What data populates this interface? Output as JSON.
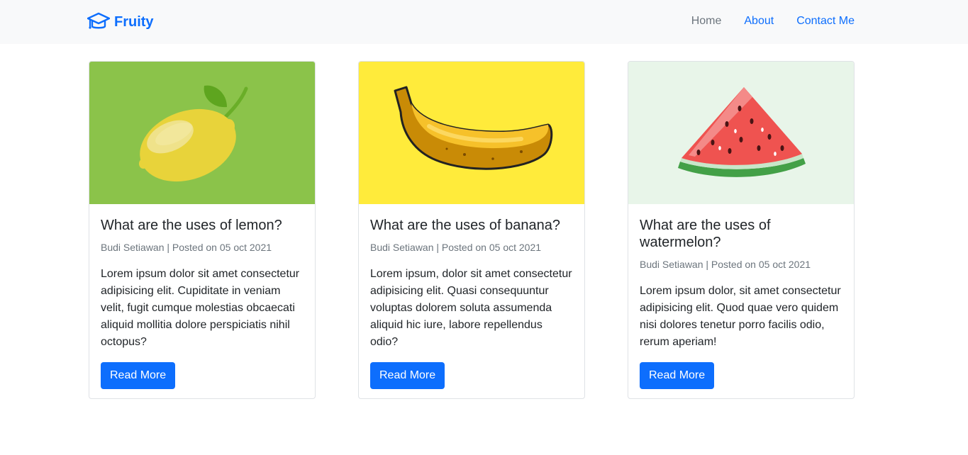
{
  "brand": {
    "name": "Fruity",
    "icon": "graduation-cap-icon",
    "color": "#0d6efd"
  },
  "nav": {
    "items": [
      {
        "label": "Home",
        "active": true
      },
      {
        "label": "About",
        "active": false
      },
      {
        "label": "Contact Me",
        "active": false
      }
    ]
  },
  "cards": [
    {
      "image": "lemon-illustration",
      "bg": "#8bc34a",
      "title": "What are the uses of lemon?",
      "meta": "Budi Setiawan | Posted on 05 oct 2021",
      "text": "Lorem ipsum dolor sit amet consectetur adipisicing elit. Cupiditate in veniam velit, fugit cumque molestias obcaecati aliquid mollitia dolore perspiciatis nihil octopus?",
      "button": "Read More"
    },
    {
      "image": "banana-illustration",
      "bg": "#ffeb3b",
      "title": "What are the uses of banana?",
      "meta": "Budi Setiawan | Posted on 05 oct 2021",
      "text": "Lorem ipsum, dolor sit amet consectetur adipisicing elit. Quasi consequuntur voluptas dolorem soluta assumenda aliquid hic iure, labore repellendus odio?",
      "button": "Read More"
    },
    {
      "image": "watermelon-illustration",
      "bg": "#e8f5e9",
      "title": "What are the uses of watermelon?",
      "meta": "Budi Setiawan | Posted on 05 oct 2021",
      "text": "Lorem ipsum dolor, sit amet consectetur adipisicing elit. Quod quae vero quidem nisi dolores tenetur porro facilis odio, rerum aperiam!",
      "button": "Read More"
    }
  ]
}
